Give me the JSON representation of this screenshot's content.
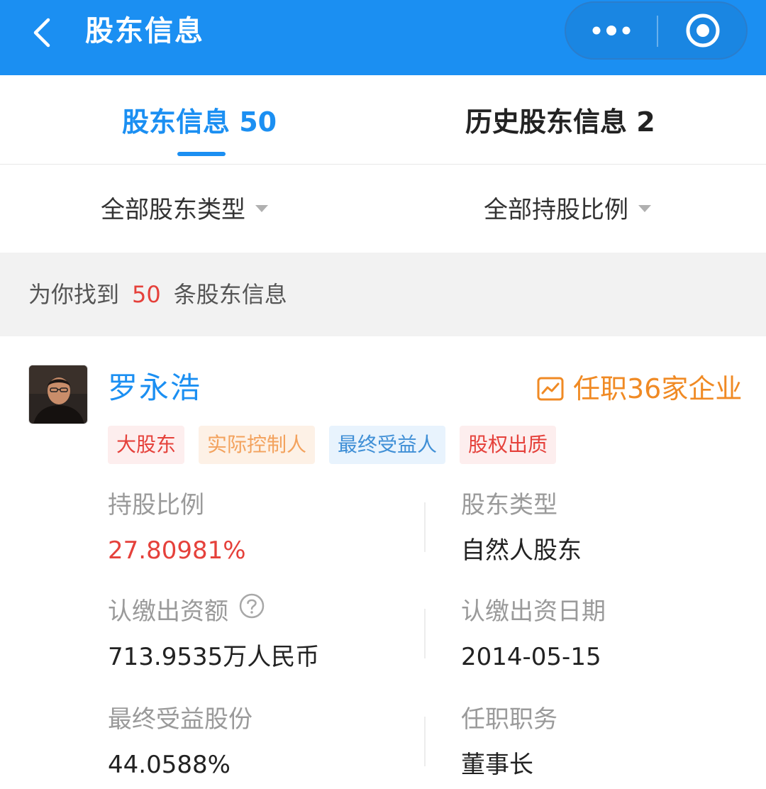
{
  "header": {
    "title": "股东信息",
    "back_icon": "chevron-left-icon",
    "more_icon": "more-dots-icon",
    "close_icon": "target-circle-icon",
    "bg_color": "#1b8ff2"
  },
  "tabs": [
    {
      "label": "股东信息 50",
      "active": true
    },
    {
      "label": "历史股东信息 2",
      "active": false
    }
  ],
  "filters": [
    {
      "label": "全部股东类型",
      "icon": "caret-down-icon"
    },
    {
      "label": "全部持股比例",
      "icon": "caret-down-icon"
    }
  ],
  "result": {
    "prefix": "为你找到",
    "count": "50",
    "suffix": "条股东信息"
  },
  "shareholder": {
    "name": "罗永浩",
    "avatar_icon": "avatar-photo",
    "positions_link": "任职36家企业",
    "positions_icon": "trend-chart-icon",
    "tags": [
      "大股东",
      "实际控制人",
      "最终受益人",
      "股权出质"
    ],
    "fields": {
      "holding_ratio_label": "持股比例",
      "holding_ratio_value": "27.80981%",
      "holder_type_label": "股东类型",
      "holder_type_value": "自然人股东",
      "subscribed_amount_label": "认缴出资额",
      "subscribed_amount_value": "713.9535万人民币",
      "subscribed_date_label": "认缴出资日期",
      "subscribed_date_value": "2014-05-15",
      "beneficial_shares_label": "最终受益股份",
      "beneficial_shares_value": "44.0588%",
      "position_label": "任职职务",
      "position_value": "董事长"
    },
    "help_icon": "question-circle-icon"
  },
  "colors": {
    "accent": "#1b8ff2",
    "highlight_red": "#e5413b",
    "link_orange": "#f08a24"
  }
}
